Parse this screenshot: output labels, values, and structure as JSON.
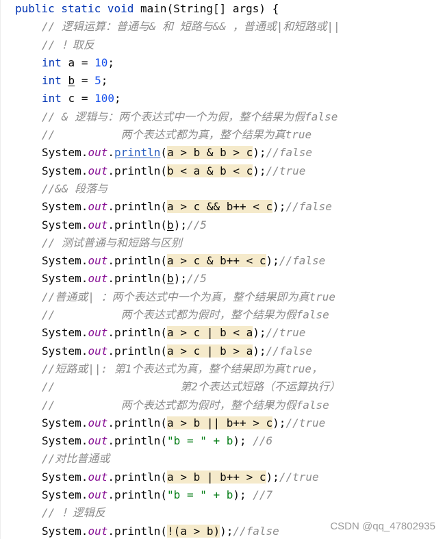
{
  "lines": [
    {
      "kind": "sig",
      "modifiers": "public static void",
      "method": "main",
      "params": "(String[] args) {"
    },
    {
      "kind": "comment",
      "text": "// 逻辑运算：普通与& 和 短路与&& ，普通或|和短路或||"
    },
    {
      "kind": "comment",
      "text": "// ！取反"
    },
    {
      "kind": "decl",
      "type": "int",
      "var": "a",
      "value": "10"
    },
    {
      "kind": "decl",
      "type": "int",
      "var": "b",
      "value": "5"
    },
    {
      "kind": "decl",
      "type": "int",
      "var": "c",
      "value": "100"
    },
    {
      "kind": "comment",
      "text": "// & 逻辑与：两个表达式中一个为假，整个结果为假false"
    },
    {
      "kind": "comment",
      "text": "//          两个表达式都为真，整个结果为真true"
    },
    {
      "kind": "print",
      "expr": "a > b & b > c",
      "tail": "//false"
    },
    {
      "kind": "print",
      "expr": "b < a & b < c",
      "tail": "//true"
    },
    {
      "kind": "comment",
      "text": "//&& 段落与"
    },
    {
      "kind": "print",
      "expr": "a > c && b++ < c",
      "tail": "//false"
    },
    {
      "kind": "print",
      "expr": "b",
      "tail": "//5"
    },
    {
      "kind": "comment",
      "text": "// 测试普通与和短路与区别"
    },
    {
      "kind": "print",
      "expr": "a > c & b++ < c",
      "tail": "//false"
    },
    {
      "kind": "print",
      "expr": "b",
      "tail": "//5"
    },
    {
      "kind": "comment",
      "text": "//普通或| ：两个表达式中一个为真，整个结果即为真true"
    },
    {
      "kind": "comment",
      "text": "//          两个表达式都为假时，整个结果为假false"
    },
    {
      "kind": "print",
      "expr": "a > c | b < a",
      "tail": "//true"
    },
    {
      "kind": "print",
      "expr": "a > c | b > a",
      "tail": "//false"
    },
    {
      "kind": "comment",
      "text": "//短路或||: 第1个表达式为真，整个结果即为真true，"
    },
    {
      "kind": "comment",
      "text": "//                   第2个表达式短路（不运算执行）"
    },
    {
      "kind": "comment",
      "text": "//          两个表达式都为假时，整个结果为假false"
    },
    {
      "kind": "print",
      "expr": "a > b || b++ > c",
      "tail": "//true"
    },
    {
      "kind": "print",
      "expr": "\"b = \" + b",
      "tail": " //6"
    },
    {
      "kind": "comment",
      "text": "//对比普通或"
    },
    {
      "kind": "print",
      "expr": "a > b | b++ > c",
      "tail": "//true"
    },
    {
      "kind": "print",
      "expr": "\"b = \" + b",
      "tail": " //7"
    },
    {
      "kind": "comment",
      "text": "// ！逻辑反"
    },
    {
      "kind": "print",
      "expr": "!(a > b)",
      "tail": "//false"
    }
  ],
  "watermark": "CSDN @qq_47802935"
}
